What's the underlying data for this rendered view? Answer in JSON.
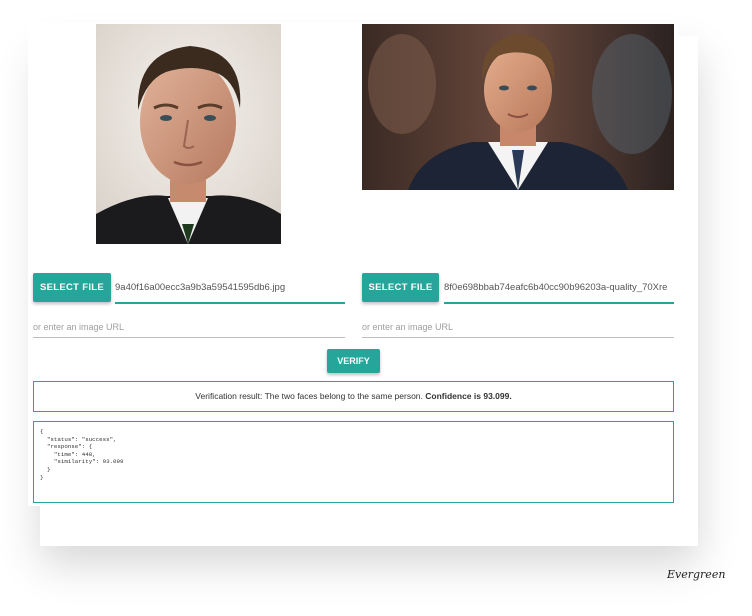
{
  "left_panel": {
    "select_label": "SELECT FILE",
    "file_name": "9a40f16a00ecc3a9b3a59541595db6.jpg",
    "url_placeholder": "or enter an image URL"
  },
  "right_panel": {
    "select_label": "SELECT FILE",
    "file_name": "8f0e698bbab74eafc6b40cc90b96203a-quality_70Xre",
    "url_placeholder": "or enter an image URL"
  },
  "verify_label": "VERIFY",
  "result": {
    "prefix": "Verification result: The two faces belong to the same person. ",
    "confidence": "Confidence is 93.099."
  },
  "response_json": "{\n  \"status\": \"success\",\n  \"response\": {\n    \"time\": 448,\n    \"similarity\": 93.099\n  }\n}",
  "brand": "Evergreen",
  "colors": {
    "accent": "#26a69a"
  }
}
